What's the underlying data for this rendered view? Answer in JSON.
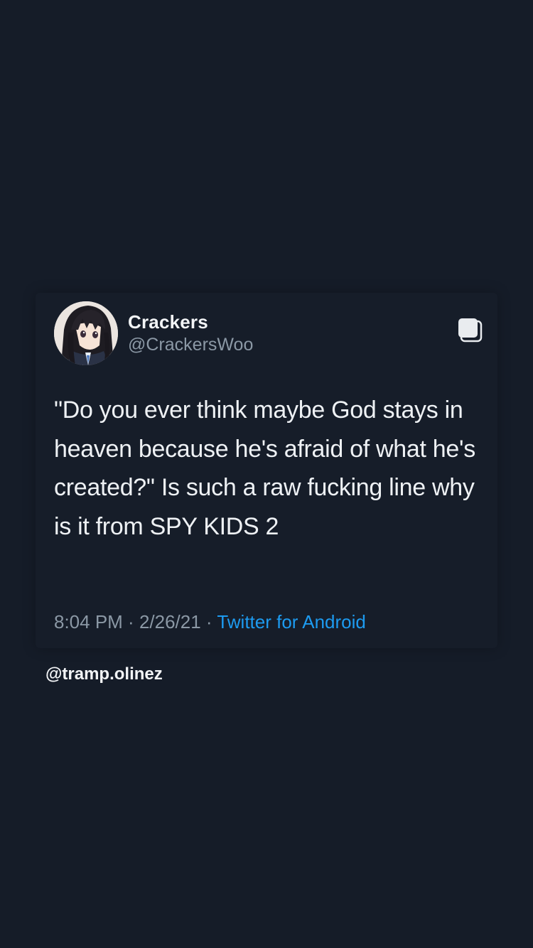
{
  "tweet": {
    "display_name": "Crackers",
    "handle": "@CrackersWoo",
    "text": "\"Do you ever think maybe God stays in heaven because he's afraid of what he's created?\" Is such a raw fucking line why is it from SPY KIDS 2",
    "time": "8:04 PM",
    "separator": " · ",
    "date": "2/26/21",
    "source": "Twitter for Android",
    "avatar_icon": "anime-character-avatar",
    "action_icon": "copy-icon"
  },
  "watermark": "@tramp.olinez",
  "colors": {
    "background": "#151c28",
    "text": "#eef1f4",
    "muted": "#8b98a5",
    "link": "#1d9bf0"
  }
}
